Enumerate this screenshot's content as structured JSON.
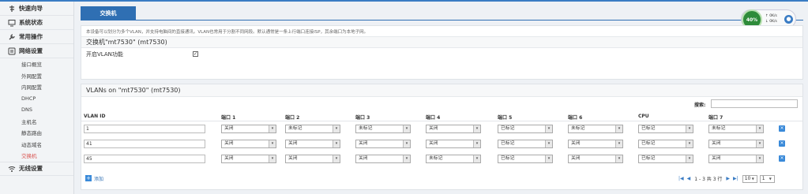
{
  "sidebar": {
    "sections": [
      {
        "icon": "signpost-icon",
        "label": "快速向导"
      },
      {
        "icon": "monitor-icon",
        "label": "系统状态"
      },
      {
        "icon": "wrench-icon",
        "label": "常用操作"
      },
      {
        "icon": "network-icon",
        "label": "网络设置"
      }
    ],
    "network_items": [
      "接口概览",
      "外网配置",
      "内网配置",
      "DHCP",
      "DNS",
      "主机名",
      "静态路由",
      "动态域名",
      "交换机"
    ],
    "wireless": {
      "icon": "wifi-icon",
      "label": "无线设置"
    }
  },
  "tab": {
    "label": "交换机"
  },
  "gauge": {
    "percent": "40%",
    "up": "0K/s",
    "down": "0K/s"
  },
  "switch_panel": {
    "description": "本设备可以划分为多个VLAN，并支持电脑间的直接通讯。VLAN也常用于分割不同网段。默认通常是一条上行端口连接ISP，其余端口为本地子网。",
    "title": "交换机\"mt7530\" (mt7530)",
    "enable_vlan_label": "开启VLAN功能",
    "enable_vlan_checked": true
  },
  "vlan_panel": {
    "title": "VLANs on \"mt7530\" (mt7530)",
    "search_label": "搜索:",
    "columns": [
      "VLAN ID",
      "端口 1",
      "端口 2",
      "端口 3",
      "端口 4",
      "端口 5",
      "端口 6",
      "CPU",
      "端口 7"
    ],
    "rows": [
      {
        "vlan_id": "1",
        "ports": [
          "关闭",
          "未标记",
          "未标记",
          "关闭",
          "已标记",
          "未标记",
          "已标记",
          "未标记"
        ]
      },
      {
        "vlan_id": "41",
        "ports": [
          "关闭",
          "关闭",
          "关闭",
          "关闭",
          "已标记",
          "关闭",
          "已标记",
          "关闭"
        ]
      },
      {
        "vlan_id": "45",
        "ports": [
          "关闭",
          "关闭",
          "关闭",
          "未标记",
          "已标记",
          "关闭",
          "已标记",
          "关闭"
        ]
      }
    ],
    "add_label": "添加",
    "pager": {
      "info": "1 - 3 共 3 行",
      "page_size": "10",
      "page": "1"
    }
  },
  "colors": {
    "accent": "#2f6fb3",
    "active_menu": "#d9534f",
    "gauge": "#2e8b3a"
  }
}
